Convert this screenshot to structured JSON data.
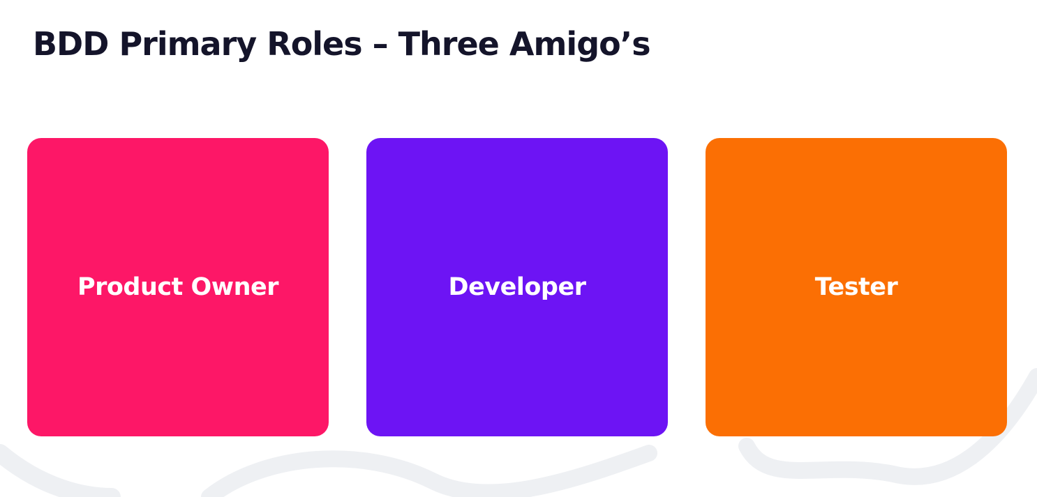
{
  "title": "BDD Primary Roles – Three Amigo’s",
  "roles": [
    {
      "label": "Product Owner",
      "color": "#fd1767"
    },
    {
      "label": "Developer",
      "color": "#6d14f4"
    },
    {
      "label": "Tester",
      "color": "#fb6f04"
    }
  ],
  "colors": {
    "title_text": "#14142a",
    "card_text": "#ffffff",
    "background": "#ffffff",
    "decoration": "#eef0f3"
  }
}
